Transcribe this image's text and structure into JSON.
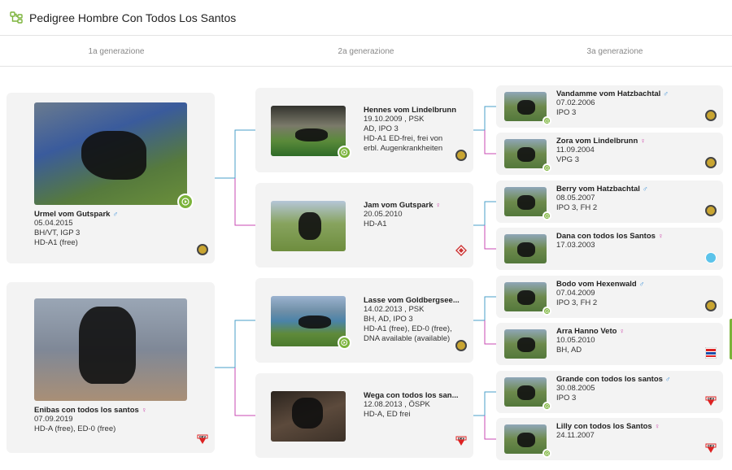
{
  "header": {
    "title": "Pedigree Hombre Con Todos Los Santos"
  },
  "generations": [
    "1a generazione",
    "2a generazione",
    "3a generazione"
  ],
  "gen1": [
    {
      "name": "Urmel vom Gutspark",
      "sex": "♂",
      "date": "05.04.2015",
      "l1": "BH/VT, IGP 3",
      "l2": "HD-A1 (free)",
      "badge": "club-badge"
    },
    {
      "name": "Enibas con todos los santos",
      "sex": "♀",
      "date": "07.09.2019",
      "l1": "HD-A (free), ED-0 (free)",
      "badge": "okv-badge"
    }
  ],
  "gen2": [
    {
      "name": "Hennes vom Lindelbrunn",
      "sex": "",
      "date": "19.10.2009 , PSK",
      "l1": "AD, IPO 3",
      "l2": "HD-A1 ED-frei, frei von",
      "l3": "erbl. Augenkrankheiten",
      "badge": "club-badge"
    },
    {
      "name": "Jam vom Gutspark",
      "sex": "♀",
      "date": "20.05.2010",
      "l1": "HD-A1",
      "badge": "diamond-badge"
    },
    {
      "name": "Lasse vom Goldbergsee...",
      "sex": "",
      "date": "14.02.2013 , PSK",
      "l1": "BH, AD, IPO 3",
      "l2": "HD-A1 (free), ED-0 (free),",
      "l3": "DNA available (available)",
      "badge": "club-badge"
    },
    {
      "name": "Wega con todos los san...",
      "sex": "",
      "date": "12.08.2013 , ÖSPK",
      "l1": "HD-A, ED frei",
      "badge": "okv-badge"
    }
  ],
  "gen3": [
    {
      "name": "Vandamme vom Hatzbachtal",
      "sex": "♂",
      "date": "07.02.2006",
      "l1": "IPO 3",
      "badge": "club-badge"
    },
    {
      "name": "Zora vom Lindelbrunn",
      "sex": "♀",
      "date": "11.09.2004",
      "l1": "VPG 3",
      "badge": "club-badge"
    },
    {
      "name": "Berry vom Hatzbachtal",
      "sex": "♂",
      "date": "08.05.2007",
      "l1": "IPO 3, FH 2",
      "badge": "club-badge"
    },
    {
      "name": "Dana con todos los Santos",
      "sex": "♀",
      "date": "17.03.2003",
      "l1": "",
      "badge": "blue-badge"
    },
    {
      "name": "Bodo vom Hexenwald",
      "sex": "♂",
      "date": "07.04.2009",
      "l1": "IPO 3, FH 2",
      "badge": "club-badge"
    },
    {
      "name": "Arra Hanno Veto",
      "sex": "♀",
      "date": "10.05.2010",
      "l1": "BH, AD",
      "badge": "flag-badge"
    },
    {
      "name": "Grande con todos los santos",
      "sex": "♂",
      "date": "30.08.2005",
      "l1": "IPO 3",
      "badge": "okv-badge"
    },
    {
      "name": "Lilly con todos los Santos",
      "sex": "♀",
      "date": "24.11.2007",
      "l1": "",
      "badge": "okv-badge"
    }
  ],
  "colors": {
    "accent": "#7bb33a",
    "male_line": "#4a9fc9",
    "female_line": "#c94ab3"
  }
}
